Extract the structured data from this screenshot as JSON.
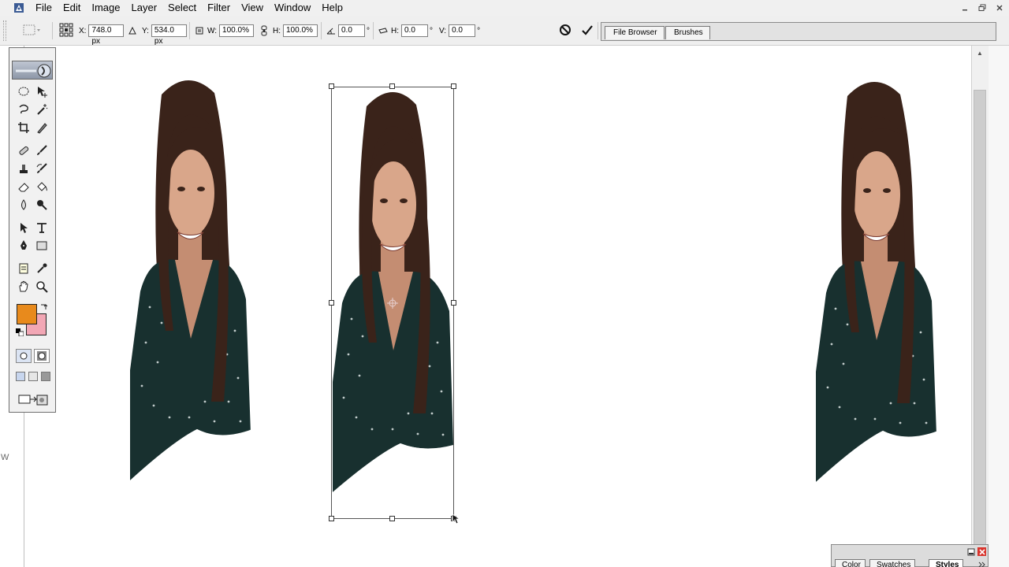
{
  "menu": {
    "items": [
      "File",
      "Edit",
      "Image",
      "Layer",
      "Select",
      "Filter",
      "View",
      "Window",
      "Help"
    ]
  },
  "options_bar": {
    "x_label": "X:",
    "x_value": "748.0 px",
    "y_label": "Y:",
    "y_value": "534.0 px",
    "w_label": "W:",
    "w_value": "100.0%",
    "h_label": "H:",
    "h_value": "100.0%",
    "angle_value": "0.0",
    "angle_unit": "°",
    "hskew_label": "H:",
    "hskew_value": "0.0",
    "hskew_unit": "°",
    "vskew_label": "V:",
    "vskew_value": "0.0",
    "vskew_unit": "°",
    "icons": [
      "reference-point-icon",
      "delta-icon",
      "link-icon",
      "angle-icon",
      "skew-icon",
      "cancel-icon",
      "commit-icon"
    ]
  },
  "palette_well": {
    "tabs": [
      "File Browser",
      "Brushes"
    ]
  },
  "bottom_palette": {
    "tabs": [
      "Color",
      "Swatches",
      "Styles"
    ],
    "active_tab": "Styles"
  },
  "toolbox": {
    "foreground_color": "#e88a1c",
    "background_color": "#f2a7b5",
    "tools": [
      "marquee",
      "move",
      "lasso",
      "magic-wand",
      "crop",
      "slice",
      "healing-brush",
      "brush",
      "clone-stamp",
      "history-brush",
      "eraser",
      "paint-bucket",
      "blur",
      "dodge",
      "path-selection",
      "type",
      "pen",
      "shape",
      "notes",
      "eyedropper",
      "hand",
      "zoom"
    ]
  },
  "canvas": {
    "figures": [
      "woman-figure-left",
      "woman-figure-selected",
      "woman-figure-right"
    ]
  },
  "side_text": "W"
}
